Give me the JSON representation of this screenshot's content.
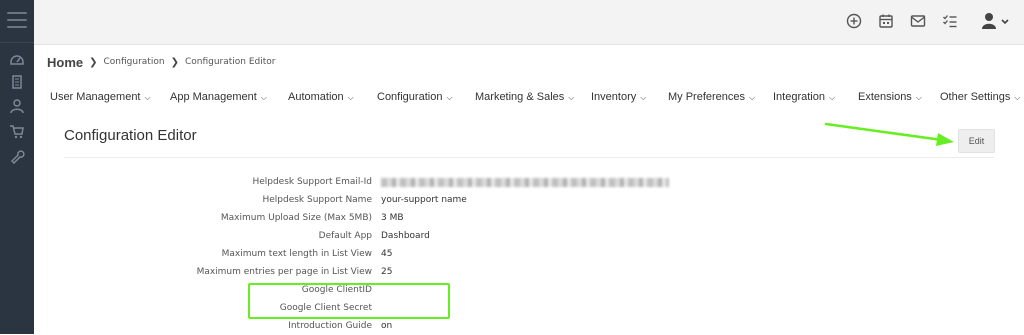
{
  "breadcrumb": {
    "home": "Home",
    "items": [
      "Configuration",
      "Configuration Editor"
    ]
  },
  "menu": [
    {
      "label": "User Management"
    },
    {
      "label": "App Management"
    },
    {
      "label": "Automation"
    },
    {
      "label": "Configuration"
    },
    {
      "label": "Marketing & Sales"
    },
    {
      "label": "Inventory"
    },
    {
      "label": "My Preferences"
    },
    {
      "label": "Integration"
    },
    {
      "label": "Extensions"
    },
    {
      "label": "Other Settings"
    }
  ],
  "editor": {
    "title": "Configuration Editor",
    "edit_label": "Edit"
  },
  "settings": [
    {
      "label": "Helpdesk Support Email-Id",
      "value": ""
    },
    {
      "label": "Helpdesk Support Name",
      "value": "your-support name"
    },
    {
      "label": "Maximum Upload Size (Max 5MB)",
      "value": "3 MB"
    },
    {
      "label": "Default App",
      "value": "Dashboard"
    },
    {
      "label": "Maximum text length in List View",
      "value": "45"
    },
    {
      "label": "Maximum entries per page in List View",
      "value": "25"
    },
    {
      "label": "Google ClientID",
      "value": ""
    },
    {
      "label": "Google Client Secret",
      "value": ""
    },
    {
      "label": "Introduction Guide",
      "value": "on"
    }
  ],
  "colors": {
    "sidebar": "#2b3441",
    "annotation": "#66ee22"
  },
  "icons": {
    "sidebar": [
      "dashboard-icon",
      "building-icon",
      "user-icon",
      "shopping-cart-icon",
      "wrench-icon"
    ],
    "topbar": [
      "add-circle-icon",
      "calendar-icon",
      "mail-icon",
      "tasks-icon",
      "user-avatar-icon"
    ]
  }
}
